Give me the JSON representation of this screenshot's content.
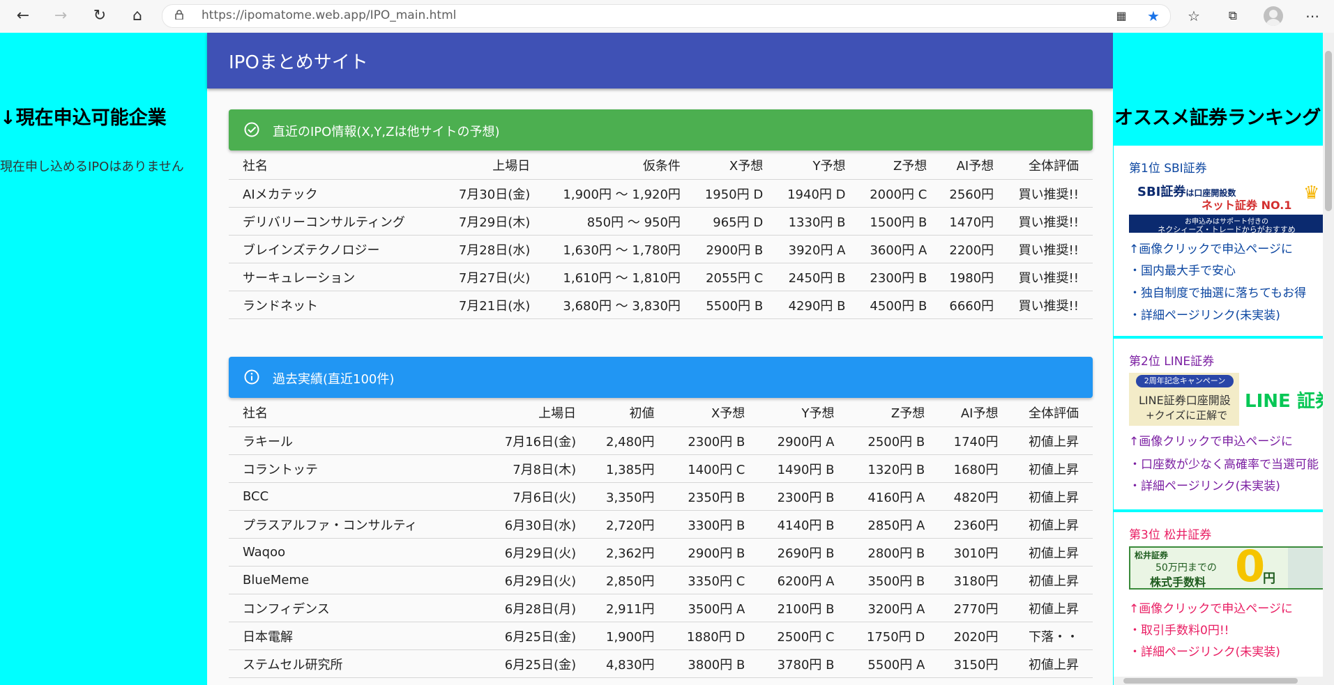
{
  "browser": {
    "url_host": "https://ipomatome.web.app",
    "url_path": "/IPO_main.html"
  },
  "left_panel": {
    "heading": "↓現在申込可能企業",
    "message": "現在申し込めるIPOはありません"
  },
  "header": {
    "title": "IPOまとめサイト"
  },
  "recent": {
    "title": "直近のIPO情報(X,Y,Zは他サイトの予想)",
    "columns": [
      "社名",
      "上場日",
      "仮条件",
      "X予想",
      "Y予想",
      "Z予想",
      "AI予想",
      "全体評価"
    ],
    "rows": [
      [
        "AIメカテック",
        "7月30日(金)",
        "1,900円 ～ 1,920円",
        "1950円 D",
        "1940円 D",
        "2000円 C",
        "2560円",
        "買い推奨!!"
      ],
      [
        "デリバリーコンサルティング",
        "7月29日(木)",
        "850円 ～ 950円",
        "965円 D",
        "1330円 B",
        "1500円 B",
        "1470円",
        "買い推奨!!"
      ],
      [
        "ブレインズテクノロジー",
        "7月28日(水)",
        "1,630円 ～ 1,780円",
        "2900円 B",
        "3920円 A",
        "3600円 A",
        "2200円",
        "買い推奨!!"
      ],
      [
        "サーキュレーション",
        "7月27日(火)",
        "1,610円 ～ 1,810円",
        "2055円 C",
        "2450円 B",
        "2300円 B",
        "1980円",
        "買い推奨!!"
      ],
      [
        "ランドネット",
        "7月21日(水)",
        "3,680円 ～ 3,830円",
        "5500円 B",
        "4290円 B",
        "4500円 B",
        "6660円",
        "買い推奨!!"
      ]
    ]
  },
  "past": {
    "title": "過去実績(直近100件)",
    "columns": [
      "社名",
      "上場日",
      "初値",
      "X予想",
      "Y予想",
      "Z予想",
      "AI予想",
      "全体評価"
    ],
    "rows": [
      [
        "ラキール",
        "7月16日(金)",
        "2,480円",
        "2300円 B",
        "2900円 A",
        "2500円 B",
        "1740円",
        "初値上昇"
      ],
      [
        "コラントッテ",
        "7月8日(木)",
        "1,385円",
        "1400円 C",
        "1490円 B",
        "1320円 B",
        "1680円",
        "初値上昇"
      ],
      [
        "BCC",
        "7月6日(火)",
        "3,350円",
        "2350円 B",
        "2300円 B",
        "4160円 A",
        "4820円",
        "初値上昇"
      ],
      [
        "プラスアルファ・コンサルティ",
        "6月30日(水)",
        "2,720円",
        "3300円 B",
        "4140円 B",
        "2850円 A",
        "2360円",
        "初値上昇"
      ],
      [
        "Waqoo",
        "6月29日(火)",
        "2,362円",
        "2900円 B",
        "2690円 B",
        "2800円 B",
        "3010円",
        "初値上昇"
      ],
      [
        "BlueMeme",
        "6月29日(火)",
        "2,850円",
        "3350円 C",
        "6200円 A",
        "3500円 B",
        "3180円",
        "初値上昇"
      ],
      [
        "コンフィデンス",
        "6月28日(月)",
        "2,911円",
        "3500円 A",
        "2100円 B",
        "3200円 A",
        "2770円",
        "初値上昇"
      ],
      [
        "日本電解",
        "6月25日(金)",
        "1,900円",
        "1880円 D",
        "2500円 C",
        "1750円 D",
        "2020円",
        "下落・・"
      ],
      [
        "ステムセル研究所",
        "6月25日(金)",
        "4,830円",
        "3800円 B",
        "3780円 B",
        "5500円 A",
        "3150円",
        "初値上昇"
      ]
    ]
  },
  "ranking": {
    "heading": "オススメ証券ランキング",
    "cards": [
      {
        "rank": "第1位 SBI証券",
        "banner_line1": "SBI証券",
        "banner_line1b": "は口座開設数",
        "banner_line2": "ネット証券 NO.1",
        "banner_line3": "お申込みはサポート付きの",
        "banner_line4": "ネクシィーズ・トレードからがおすすめ",
        "link": "↑画像クリックで申込ページに",
        "points": [
          "・国内最大手で安心",
          "・独自制度で抽選に落ちてもお得",
          "・詳細ページリンク(未実装)"
        ]
      },
      {
        "rank": "第2位 LINE証券",
        "banner_line1": "2周年記念キャンペーン",
        "banner_line2": "LINE証券口座開設",
        "banner_line3": "+クイズに正解で",
        "banner_logo": "LINE 証券",
        "link": "↑画像クリックで申込ページに",
        "points": [
          "・口座数が少なく高確率で当選可能",
          "・詳細ページリンク(未実装)"
        ]
      },
      {
        "rank": "第3位 松井証券",
        "banner_line1": "松井証券",
        "banner_line2": "50万円までの",
        "banner_line3": "株式手数料",
        "banner_big": "0",
        "banner_unit": "円",
        "link": "↑画像クリックで申込ページに",
        "points": [
          "・取引手数料0円!!",
          "・詳細ページリンク(未実装)"
        ]
      }
    ]
  }
}
